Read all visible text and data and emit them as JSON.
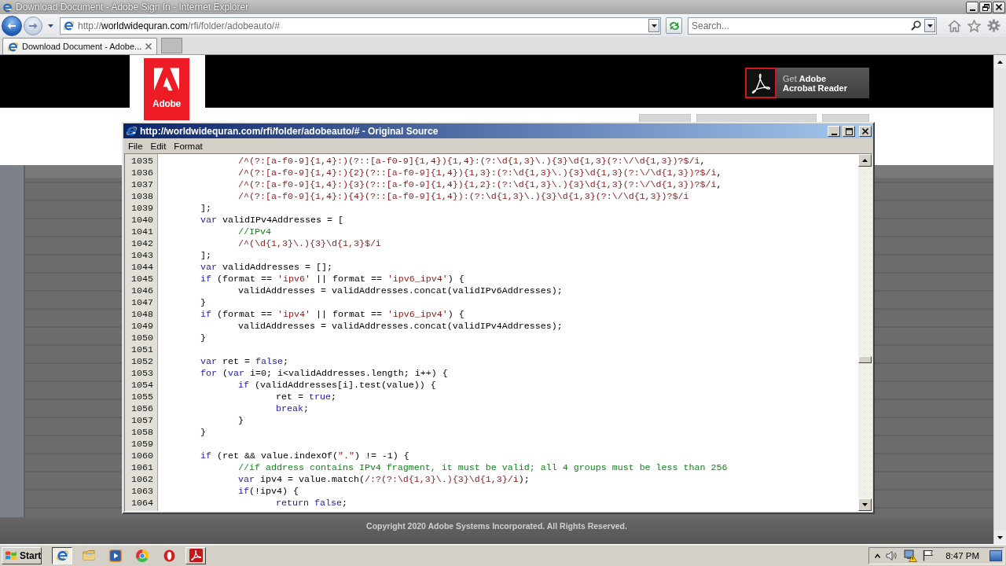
{
  "browser": {
    "title": "Download Document - Adobe Sign In - Internet Explorer",
    "nav_buttons": [
      {
        "kind": "back",
        "disabled": false
      },
      {
        "kind": "forward",
        "disabled": true
      }
    ],
    "address": {
      "parts": [
        {
          "text": "http://",
          "highlight": false
        },
        {
          "text": "worldwidequran.com",
          "highlight": true
        },
        {
          "text": "/rfi/folder/adobeauto/#",
          "highlight": false
        }
      ]
    },
    "search": {
      "placeholder": "Search..."
    },
    "tabs": [
      {
        "label": "Download Document - Adobe...",
        "selected": true
      }
    ]
  },
  "page": {
    "logo": {
      "wordmark": "Adobe"
    },
    "reader_button": {
      "lines": [
        "Get **Adobe**",
        "Acrobat Reader"
      ]
    },
    "copyright": "Copyright 2020 Adobe Systems Incorporated. All Rights Reserved."
  },
  "source_window": {
    "title": "http://worldwidequran.com/rfi/folder/adobeauto/# - Original Source",
    "menu": [
      "File",
      "Edit",
      "Format"
    ],
    "lines": [
      {
        "number": "1035",
        "tokens": [
          {
            "kind": "regex",
            "text": "\t\t/^(?:[a-f0-9]{1,4}:)(?::[a-f0-9]{1,4}){1,4}:(?:\\d{1,3}\\.){3}\\d{1,3}(?:\\/\\d{1,3})?$/i"
          },
          {
            "kind": "plain",
            "text": ","
          }
        ]
      },
      {
        "number": "1036",
        "tokens": [
          {
            "kind": "regex",
            "text": "\t\t/^(?:[a-f0-9]{1,4}:){2}(?::[a-f0-9]{1,4}){1,3}:(?:\\d{1,3}\\.){3}\\d{1,3}(?:\\/\\d{1,3})?$/i"
          },
          {
            "kind": "plain",
            "text": ","
          }
        ]
      },
      {
        "number": "1037",
        "tokens": [
          {
            "kind": "regex",
            "text": "\t\t/^(?:[a-f0-9]{1,4}:){3}(?::[a-f0-9]{1,4}){1,2}:(?:\\d{1,3}\\.){3}\\d{1,3}(?:\\/\\d{1,3})?$/i"
          },
          {
            "kind": "plain",
            "text": ","
          }
        ]
      },
      {
        "number": "1038",
        "tokens": [
          {
            "kind": "regex",
            "text": "\t\t/^(?:[a-f0-9]{1,4}:){4}(?::[a-f0-9]{1,4}):(?:\\d{1,3}\\.){3}\\d{1,3}(?:\\/\\d{1,3})?$/i"
          }
        ]
      },
      {
        "number": "1039",
        "tokens": [
          {
            "kind": "plain",
            "text": "\t];"
          }
        ]
      },
      {
        "number": "1040",
        "tokens": [
          {
            "kind": "keyword",
            "text": "\tvar"
          },
          {
            "kind": "plain",
            "text": " validIPv4Addresses = ["
          }
        ]
      },
      {
        "number": "1041",
        "tokens": [
          {
            "kind": "comment",
            "text": "\t\t//IPv4"
          }
        ]
      },
      {
        "number": "1042",
        "tokens": [
          {
            "kind": "regex",
            "text": "\t\t/^(\\d{1,3}\\.){3}\\d{1,3}$/i"
          }
        ]
      },
      {
        "number": "1043",
        "tokens": [
          {
            "kind": "plain",
            "text": "\t];"
          }
        ]
      },
      {
        "number": "1044",
        "tokens": [
          {
            "kind": "keyword",
            "text": "\tvar"
          },
          {
            "kind": "plain",
            "text": " validAddresses = [];"
          }
        ]
      },
      {
        "number": "1045",
        "tokens": [
          {
            "kind": "keyword",
            "text": "\tif"
          },
          {
            "kind": "plain",
            "text": " (format == "
          },
          {
            "kind": "string",
            "text": "'ipv6'"
          },
          {
            "kind": "plain",
            "text": " || format == "
          },
          {
            "kind": "string",
            "text": "'ipv6_ipv4'"
          },
          {
            "kind": "plain",
            "text": ") {"
          }
        ]
      },
      {
        "number": "1046",
        "tokens": [
          {
            "kind": "plain",
            "text": "\t\tvalidAddresses = validAddresses.concat(validIPv6Addresses);"
          }
        ]
      },
      {
        "number": "1047",
        "tokens": [
          {
            "kind": "plain",
            "text": "\t}"
          }
        ]
      },
      {
        "number": "1048",
        "tokens": [
          {
            "kind": "keyword",
            "text": "\tif"
          },
          {
            "kind": "plain",
            "text": " (format == "
          },
          {
            "kind": "string",
            "text": "'ipv4'"
          },
          {
            "kind": "plain",
            "text": " || format == "
          },
          {
            "kind": "string",
            "text": "'ipv6_ipv4'"
          },
          {
            "kind": "plain",
            "text": ") {"
          }
        ]
      },
      {
        "number": "1049",
        "tokens": [
          {
            "kind": "plain",
            "text": "\t\tvalidAddresses = validAddresses.concat(validIPv4Addresses);"
          }
        ]
      },
      {
        "number": "1050",
        "tokens": [
          {
            "kind": "plain",
            "text": "\t}"
          }
        ]
      },
      {
        "number": "1051"
      },
      {
        "number": "1052",
        "tokens": [
          {
            "kind": "keyword",
            "text": "\tvar"
          },
          {
            "kind": "plain",
            "text": " ret = "
          },
          {
            "kind": "keyword",
            "text": "false"
          },
          {
            "kind": "plain",
            "text": ";"
          }
        ]
      },
      {
        "number": "1053",
        "tokens": [
          {
            "kind": "keyword",
            "text": "\tfor"
          },
          {
            "kind": "plain",
            "text": " ("
          },
          {
            "kind": "keyword",
            "text": "var"
          },
          {
            "kind": "plain",
            "text": " i=0; i<validAddresses.length; i++) {"
          }
        ]
      },
      {
        "number": "1054",
        "tokens": [
          {
            "kind": "keyword",
            "text": "\t\tif"
          },
          {
            "kind": "plain",
            "text": " (validAddresses[i].test(value)) {"
          }
        ]
      },
      {
        "number": "1055",
        "tokens": [
          {
            "kind": "plain",
            "text": "\t\t\tret = "
          },
          {
            "kind": "keyword",
            "text": "true"
          },
          {
            "kind": "plain",
            "text": ";"
          }
        ]
      },
      {
        "number": "1056",
        "tokens": [
          {
            "kind": "keyword",
            "text": "\t\t\tbreak"
          },
          {
            "kind": "plain",
            "text": ";"
          }
        ]
      },
      {
        "number": "1057",
        "tokens": [
          {
            "kind": "plain",
            "text": "\t\t}"
          }
        ]
      },
      {
        "number": "1058",
        "tokens": [
          {
            "kind": "plain",
            "text": "\t}"
          }
        ]
      },
      {
        "number": "1059"
      },
      {
        "number": "1060",
        "tokens": [
          {
            "kind": "keyword",
            "text": "\tif"
          },
          {
            "kind": "plain",
            "text": " (ret && value.indexOf("
          },
          {
            "kind": "string",
            "text": "\".\""
          },
          {
            "kind": "plain",
            "text": ") != -1) {"
          }
        ]
      },
      {
        "number": "1061",
        "tokens": [
          {
            "kind": "comment",
            "text": "\t\t//if address contains IPv4 fragment, it must be valid; all 4 groups must be less than 256"
          }
        ]
      },
      {
        "number": "1062",
        "tokens": [
          {
            "kind": "keyword",
            "text": "\t\tvar"
          },
          {
            "kind": "plain",
            "text": " ipv4 = value.match("
          },
          {
            "kind": "regex",
            "text": "/:?(?:\\d{1,3}\\.){3}\\d{1,3}/i"
          },
          {
            "kind": "plain",
            "text": ");"
          }
        ]
      },
      {
        "number": "1063",
        "tokens": [
          {
            "kind": "keyword",
            "text": "\t\tif"
          },
          {
            "kind": "plain",
            "text": "(!ipv4) {"
          }
        ]
      },
      {
        "number": "1064",
        "tokens": [
          {
            "kind": "keyword",
            "text": "\t\t\treturn false"
          },
          {
            "kind": "plain",
            "text": ";"
          }
        ]
      }
    ]
  },
  "taskbar": {
    "start": "Start",
    "apps": [
      {
        "kind": "ie",
        "running": true,
        "selected": true
      },
      {
        "kind": "explorer",
        "running": false,
        "selected": false
      },
      {
        "kind": "media",
        "running": false,
        "selected": false
      },
      {
        "kind": "chrome",
        "running": false,
        "selected": false
      },
      {
        "kind": "opera",
        "running": false,
        "selected": false
      },
      {
        "kind": "acrobat",
        "running": true,
        "selected": false
      }
    ],
    "clock": "8:47 PM"
  }
}
